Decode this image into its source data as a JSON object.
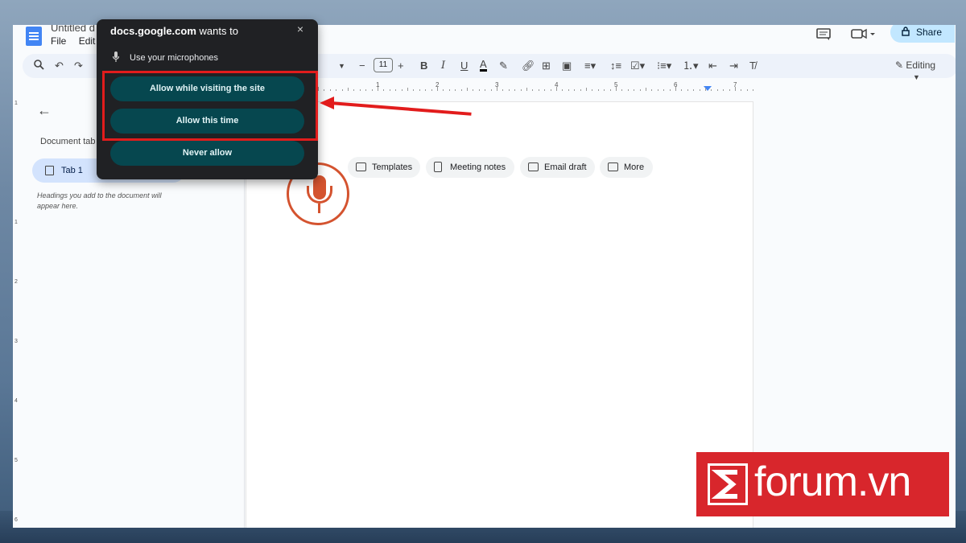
{
  "doc": {
    "title": "Untitled d",
    "menu": [
      "File",
      "Edit"
    ]
  },
  "header": {
    "share_label": "Share"
  },
  "toolbar": {
    "font_size": "11",
    "mode_label": "Editing"
  },
  "ruler": {
    "numbers": [
      "1",
      "1",
      "2",
      "3",
      "4",
      "5",
      "6",
      "7"
    ]
  },
  "sidebar": {
    "tabs_label": "Document tab",
    "tab1_label": "Tab 1",
    "hint": "Headings you add to the document will appear here."
  },
  "chips": [
    "Templates",
    "Meeting notes",
    "Email draft",
    "More"
  ],
  "popup": {
    "site": "docs.google.com",
    "title_suffix": " wants to",
    "permission": "Use your microphones",
    "close": "×",
    "allow_visit": "Allow while visiting the site",
    "allow_once": "Allow this time",
    "never": "Never allow"
  },
  "watermark": {
    "text": "forum.vn"
  },
  "colors": {
    "accent": "#06474f",
    "highlight": "#e21c1c",
    "mic": "#d4532f",
    "watermark": "#d8262c"
  }
}
